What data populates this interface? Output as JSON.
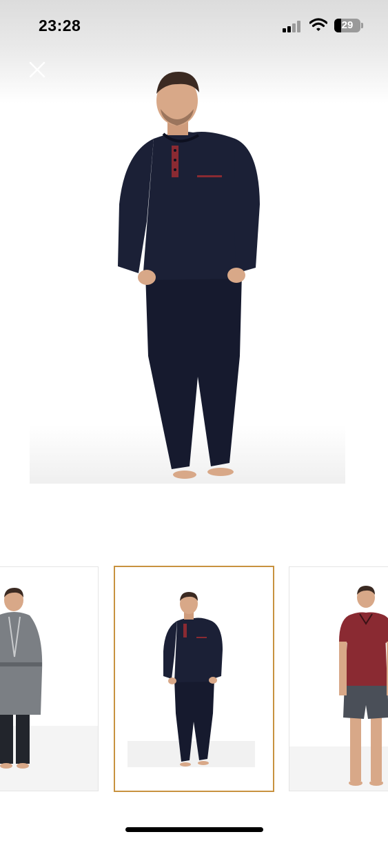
{
  "status_bar": {
    "time": "23:28",
    "battery_level": "29",
    "icons": [
      "signal-icon",
      "wifi-icon",
      "battery-icon"
    ]
  },
  "viewer": {
    "close_icon": "close-icon",
    "selected_index": 1
  },
  "thumbnails": [
    {
      "icon": "grey-robe-pajama-thumbnail"
    },
    {
      "icon": "navy-long-sleeve-pajama-thumbnail",
      "selected": true
    },
    {
      "icon": "burgundy-tshirt-shorts-pajama-thumbnail"
    }
  ],
  "colors": {
    "selected_border": "#c8923f",
    "navy": "#1b2036",
    "burgundy": "#8a2a32",
    "robe_grey": "#7b7f84",
    "shorts_grey": "#4a4f58"
  }
}
